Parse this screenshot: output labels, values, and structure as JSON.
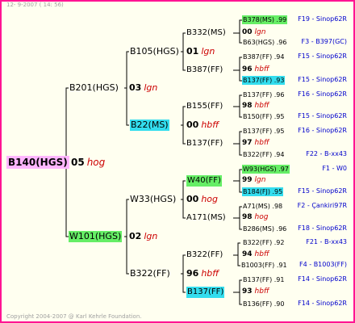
{
  "header": "12- 9-2007 ( 14: 56)",
  "footer": "Copyright 2004-2007 @ Karl Kehrle Foundation.",
  "gen0": {
    "name": "B140(HGS)",
    "year": "05",
    "place": "hog"
  },
  "gen1": [
    {
      "name": "B201(HGS)",
      "year": "03",
      "place": "lgn"
    },
    {
      "name": "W101(HGS)",
      "year": "02",
      "place": "lgn"
    }
  ],
  "gen2": [
    {
      "name": "B105(HGS)",
      "year": "01",
      "place": "lgn"
    },
    {
      "name": "B22(MS)",
      "year": "00",
      "place": "hbff"
    },
    {
      "name": "W33(HGS)",
      "year": "00",
      "place": "hog"
    },
    {
      "name": "B322(FF)",
      "year": "96",
      "place": "hbff"
    }
  ],
  "gen3": [
    {
      "name": "B332(MS)",
      "year": "00",
      "place": "lgn"
    },
    {
      "name": "B387(FF)",
      "year": "96",
      "place": "hbff"
    },
    {
      "name": "B155(FF)",
      "year": "98",
      "place": "hbff"
    },
    {
      "name": "B137(FF)",
      "year": "97",
      "place": "hbff"
    },
    {
      "name": "W40(FF)",
      "year": "99",
      "place": "lgn"
    },
    {
      "name": "A171(MS)",
      "year": "98",
      "place": "hog"
    },
    {
      "name": "B322(FF)",
      "year": "94",
      "place": "hbff"
    },
    {
      "name": "B137(FF)",
      "year": "93",
      "place": "hbff"
    }
  ],
  "gen4": [
    {
      "name": "B378(MS) .99",
      "info": "F19 - Sinop62R"
    },
    {
      "name": "B63(HGS) .96",
      "info": "F3 - B397(GC)"
    },
    {
      "name": "B387(FF) .94",
      "info": "F15 - Sinop62R"
    },
    {
      "name": "B137(FF) .93",
      "info": "F15 - Sinop62R"
    },
    {
      "name": "B137(FF) .96",
      "info": "F16 - Sinop62R"
    },
    {
      "name": "B150(FF) .95",
      "info": "F15 - Sinop62R"
    },
    {
      "name": "B137(FF) .95",
      "info": "F16 - Sinop62R"
    },
    {
      "name": "B322(FF) .94",
      "info": "F22 - B-xx43"
    },
    {
      "name": "W93(HGS) .97",
      "info": "F1 - W0"
    },
    {
      "name": "B184(FJ) .95",
      "info": "F15 - Sinop62R"
    },
    {
      "name": "A71(MS) .98",
      "info": "F2 - Çankiri97R"
    },
    {
      "name": "B286(MS) .96",
      "info": "F18 - Sinop62R"
    },
    {
      "name": "B322(FF) .92",
      "info": "F21 - B-xx43"
    },
    {
      "name": "B1003(FF) .91",
      "info": "F4 - B1003(FF)"
    },
    {
      "name": "B137(FF) .91",
      "info": "F14 - Sinop62R"
    },
    {
      "name": "B136(FF) .90",
      "info": "F14 - Sinop62R"
    }
  ],
  "colors": {
    "frame": "#ff1493",
    "root": "#ffb6ff",
    "green": "#66ee66",
    "cyan": "#33ddee",
    "place": "#cc0000",
    "info": "#0000cc"
  }
}
